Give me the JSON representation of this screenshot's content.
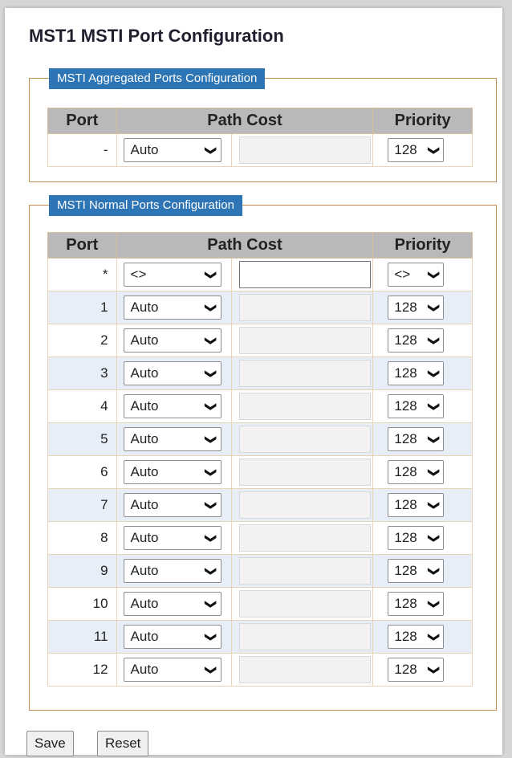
{
  "page": {
    "title": "MST1 MSTI Port Configuration"
  },
  "aggregated": {
    "legend": "MSTI Aggregated Ports Configuration",
    "headers": {
      "port": "Port",
      "path_cost": "Path Cost",
      "priority": "Priority"
    },
    "rows": [
      {
        "port": "-",
        "mode": "Auto",
        "value": "",
        "priority": "128"
      }
    ]
  },
  "normal": {
    "legend": "MSTI Normal Ports Configuration",
    "headers": {
      "port": "Port",
      "path_cost": "Path Cost",
      "priority": "Priority"
    },
    "rows": [
      {
        "port": "*",
        "mode": "<>",
        "value": "",
        "priority": "<>"
      },
      {
        "port": "1",
        "mode": "Auto",
        "value": "",
        "priority": "128"
      },
      {
        "port": "2",
        "mode": "Auto",
        "value": "",
        "priority": "128"
      },
      {
        "port": "3",
        "mode": "Auto",
        "value": "",
        "priority": "128"
      },
      {
        "port": "4",
        "mode": "Auto",
        "value": "",
        "priority": "128"
      },
      {
        "port": "5",
        "mode": "Auto",
        "value": "",
        "priority": "128"
      },
      {
        "port": "6",
        "mode": "Auto",
        "value": "",
        "priority": "128"
      },
      {
        "port": "7",
        "mode": "Auto",
        "value": "",
        "priority": "128"
      },
      {
        "port": "8",
        "mode": "Auto",
        "value": "",
        "priority": "128"
      },
      {
        "port": "9",
        "mode": "Auto",
        "value": "",
        "priority": "128"
      },
      {
        "port": "10",
        "mode": "Auto",
        "value": "",
        "priority": "128"
      },
      {
        "port": "11",
        "mode": "Auto",
        "value": "",
        "priority": "128"
      },
      {
        "port": "12",
        "mode": "Auto",
        "value": "",
        "priority": "128"
      }
    ]
  },
  "buttons": {
    "save": "Save",
    "reset": "Reset"
  },
  "icons": {
    "dropdown": "chevron-down-icon"
  },
  "colors": {
    "legend_bg": "#2e75b6",
    "header_bg": "#b9b9b9",
    "row_alt": "#e7eef8",
    "border": "#c58d52"
  }
}
